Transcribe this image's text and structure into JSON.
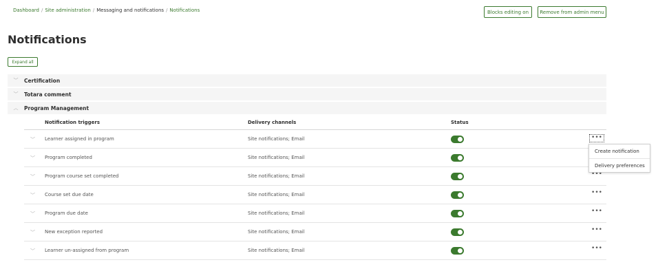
{
  "breadcrumb": {
    "items": [
      "Dashboard",
      "Site administration",
      "Messaging and notifications",
      "Notifications"
    ],
    "separator": "/"
  },
  "header_buttons": {
    "blocks_editing": "Blocks editing on",
    "remove_admin_menu": "Remove from admin menu"
  },
  "page": {
    "title": "Notifications",
    "expand_all": "Expand all"
  },
  "categories": [
    {
      "name": "Certification",
      "expanded": false
    },
    {
      "name": "Totara comment",
      "expanded": false
    },
    {
      "name": "Program Management",
      "expanded": true
    }
  ],
  "table": {
    "headers": {
      "triggers": "Notification triggers",
      "channels": "Delivery channels",
      "status": "Status"
    },
    "rows": [
      {
        "trigger": "Learner assigned in program",
        "channels": "Site notifications; Email",
        "enabled": true
      },
      {
        "trigger": "Program completed",
        "channels": "Site notifications; Email",
        "enabled": true
      },
      {
        "trigger": "Program course set completed",
        "channels": "Site notifications; Email",
        "enabled": true
      },
      {
        "trigger": "Course set due date",
        "channels": "Site notifications; Email",
        "enabled": true
      },
      {
        "trigger": "Program due date",
        "channels": "Site notifications; Email",
        "enabled": true
      },
      {
        "trigger": "New exception reported",
        "channels": "Site notifications; Email",
        "enabled": true
      },
      {
        "trigger": "Learner un-assigned from program",
        "channels": "Site notifications; Email",
        "enabled": true
      }
    ],
    "more_glyph": "•••"
  },
  "actions_menu": {
    "items": [
      "Create notification",
      "Delivery preferences"
    ]
  },
  "colors": {
    "accent": "#3b7a2e",
    "category_bg": "#f5f5f5"
  },
  "icons": {
    "collapsed": "chevron-down-icon",
    "expanded": "chevron-up-icon",
    "more": "more-icon"
  }
}
